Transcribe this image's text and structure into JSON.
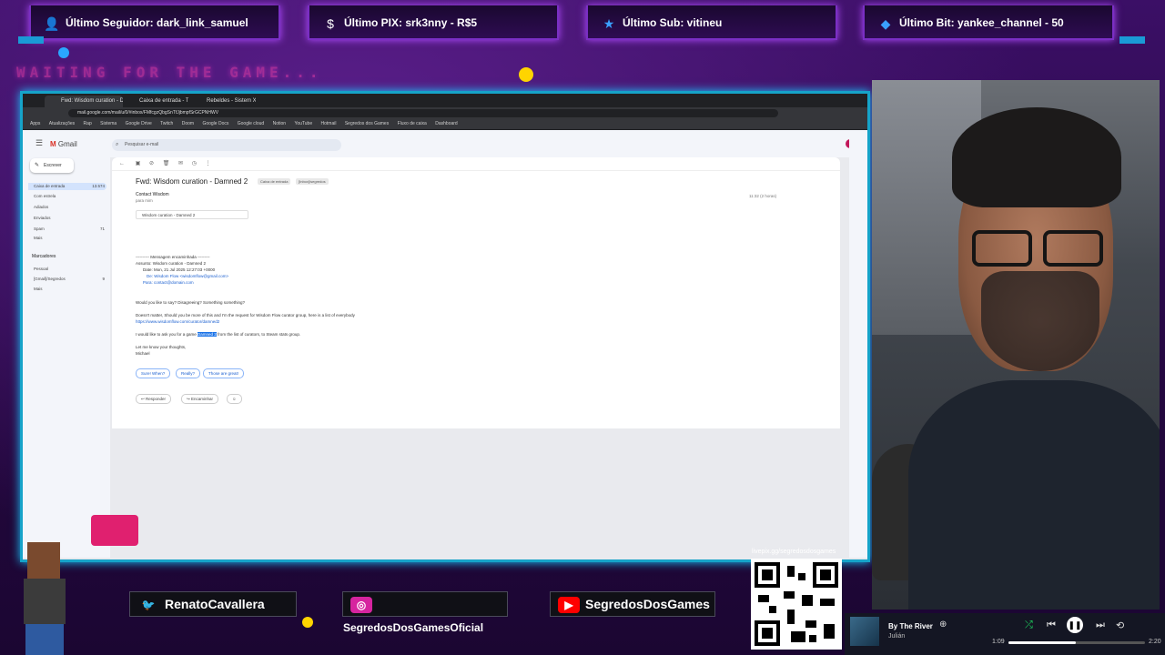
{
  "alerts": [
    {
      "icon": "user-icon",
      "text": "Último Seguidor: dark_link_samuel"
    },
    {
      "icon": "dollar-icon",
      "text": "Último PIX: srk3nny - R$5"
    },
    {
      "icon": "star-icon",
      "text": "Último Sub: vitineu"
    },
    {
      "icon": "diamond-icon",
      "text": "Último Bit: yankee_channel - 50"
    }
  ],
  "overlay": {
    "waiting": "WAITING FOR THE GAME..."
  },
  "browser": {
    "tabs": [
      "Fwd: Wisdom curation - Damned",
      "Caixa de entrada - Twitch",
      "Rebeldes - Sistem XX"
    ],
    "url": "mail.google.com/mail/u/0/#inbox/FMfcgzQbgSnTfJjbmpfSrGCPNHWV",
    "bookmarks": [
      "Apps",
      "Atualizações",
      "Rap",
      "Sistema",
      "Google Drive",
      "Twitch",
      "Doom",
      "Google Docs",
      "Google cloud",
      "Notion",
      "YouTube",
      "Hotmail",
      "Segredos dos Games",
      "Fluxo de caixa",
      "Dashboard"
    ]
  },
  "gmail": {
    "brand": "Gmail",
    "search_placeholder": "Pesquisar e-mail",
    "compose": "Escrever",
    "nav": [
      {
        "label": "Caixa de entrada",
        "count": "13.574"
      },
      {
        "label": "Com estrela",
        "count": ""
      },
      {
        "label": "Adiados",
        "count": ""
      },
      {
        "label": "Enviados",
        "count": ""
      },
      {
        "label": "Spam",
        "count": "71"
      },
      {
        "label": "Mais",
        "count": ""
      }
    ],
    "labels_header": "Marcadores",
    "labels": [
      {
        "label": "Pessoal",
        "count": ""
      },
      {
        "label": "[Gmail]/Segredos",
        "count": "9"
      },
      {
        "label": "Mais",
        "count": ""
      }
    ]
  },
  "email": {
    "subject": "Fwd: Wisdom curation - Damned 2",
    "tags": [
      "Caixa de entrada",
      "[Inbox]/segredos"
    ],
    "sender": "Contact Wisdom",
    "to": "para mim",
    "date": "11:32 (2 horas)",
    "attachment": "Wisdom curation - Damned 2",
    "forward_header": "---------- Mensagem encaminhada ---------",
    "fwd_subject": "Assunto: Wisdom curation - Damned 2",
    "fwd_date": "Date: Mon, 21 Jul 2025 12:27:03 +0000",
    "fwd_from": "De: Wisdom Flow <wisdomflow@gmail.com>",
    "fwd_to": "Para: contact@domain.com",
    "line1": "Would you like to say? Disagreeing? Something something?",
    "line2": "Doesn't matter, Should you be more of this and I'm the request for Wisdom Flow curator group, here is a list of everybody",
    "line2_link": "https://www.wisdomflow.com/curator/damned2",
    "line3_pre": "I would like to ask you for a game ",
    "line3_highlight": "Damned 2",
    "line3_post": " from the list of curators, to Steam stats group.",
    "signoff": "Let me know your thoughts,",
    "signature": "Michael",
    "smart_replies": [
      "Sure! When?",
      "Really?",
      "Those are great!"
    ],
    "actions": [
      "Responder",
      "Encaminhar"
    ]
  },
  "socials": [
    {
      "icon": "twitter-icon",
      "handle": "RenatoCavallera",
      "color": "#1d9bf0"
    },
    {
      "icon": "instagram-icon",
      "handle": "SegredosDosGamesOficial",
      "color": "#d6249f"
    },
    {
      "icon": "youtube-icon",
      "handle": "SegredosDosGames",
      "color": "#ff0000"
    }
  ],
  "livepix": "livepix.gg/segredosdosgames",
  "player": {
    "title": "By The River",
    "artist": "Julián",
    "elapsed": "1:09",
    "duration": "2:20",
    "progress": 0.49
  }
}
